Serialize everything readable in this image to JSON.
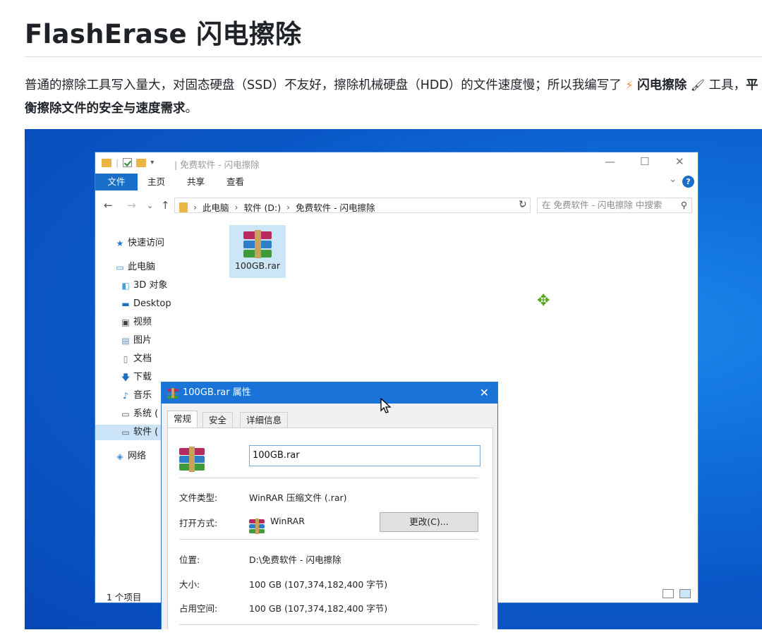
{
  "doc": {
    "title": "FlashErase 闪电擦除",
    "intro_plain": "普通的擦除工具写入量大，对固态硬盘（SSD）不友好，擦除机械硬盘（HDD）的文件速度慢；所以我编写了",
    "intro_bold_name": "闪电擦除",
    "intro_tool": "工具，",
    "intro_bold_end": "平衡擦除文件的安全与速度需求",
    "intro_period": "。",
    "emoji_lightning": "⚡",
    "emoji_brush": "🖌"
  },
  "explorer": {
    "title": "| 免费软件 - 闪电擦除",
    "ribbon": {
      "file": "文件",
      "home": "主页",
      "share": "共享",
      "view": "查看",
      "help": "?"
    },
    "address": {
      "pc": "此电脑",
      "drive": "软件 (D:)",
      "folder": "免费软件 - 闪电擦除"
    },
    "search_placeholder": "在 免费软件 - 闪电擦除 中搜索",
    "sidebar": {
      "quick": "快速访问",
      "pc": "此电脑",
      "obj3d": "3D 对象",
      "desktop": "Desktop",
      "video": "视频",
      "pictures": "图片",
      "docs": "文档",
      "downloads": "下载",
      "music": "音乐",
      "system": "系统 (",
      "software": "软件 (",
      "network": "网络"
    },
    "file_name": "100GB.rar",
    "status": "1 个项目"
  },
  "dialog": {
    "title": "100GB.rar 属性",
    "tabs": [
      "常规",
      "安全",
      "详细信息"
    ],
    "name_value": "100GB.rar",
    "type_label": "文件类型:",
    "type_value": "WinRAR 压缩文件 (.rar)",
    "open_label": "打开方式:",
    "open_value": "WinRAR",
    "change_button": "更改(C)...",
    "location_label": "位置:",
    "location_value": "D:\\免费软件 - 闪电擦除",
    "size_label": "大小:",
    "size_value": "100 GB (107,374,182,400 字节)",
    "disk_label": "占用空间:",
    "disk_value": "100 GB (107,374,182,400 字节)"
  },
  "colors": {
    "accent": "#1a6fc9",
    "desktop_blue": "#0a58c7",
    "selection": "#cde6f7"
  }
}
